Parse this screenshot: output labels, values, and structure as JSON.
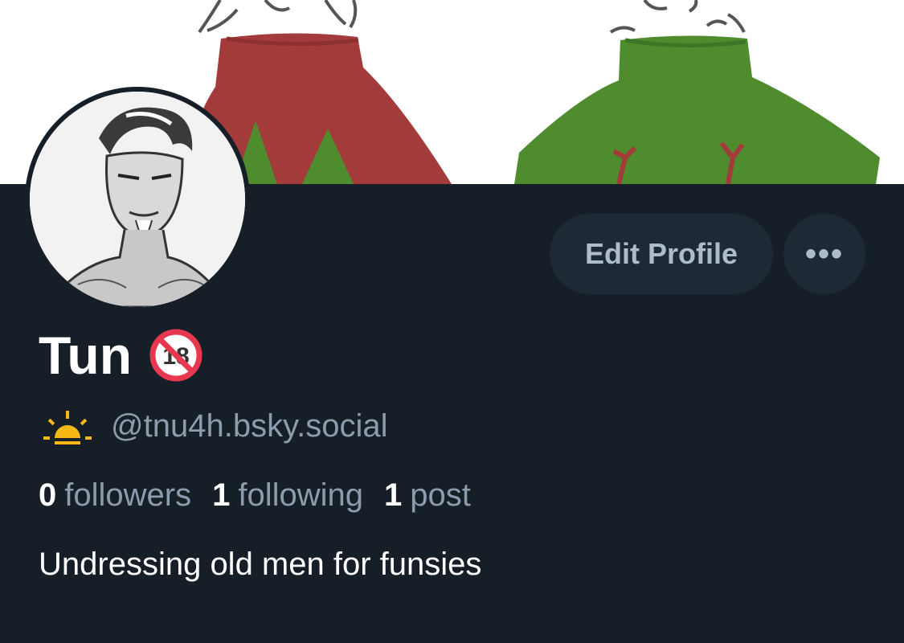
{
  "profile": {
    "display_name": "Tun",
    "name_badge_icon": "no-under-18-icon",
    "status_icon": "sunrise-icon",
    "handle": "@tnu4h.bsky.social",
    "bio": "Undressing old men for funsies",
    "stats": [
      {
        "count": "0",
        "label": "followers"
      },
      {
        "count": "1",
        "label": "following"
      },
      {
        "count": "1",
        "label": "post"
      }
    ]
  },
  "actions": {
    "edit_label": "Edit Profile",
    "more_label": "•••"
  },
  "colors": {
    "background": "#161e27",
    "button_bg": "#1e2936",
    "button_text": "#aebbc9",
    "secondary_text": "#8c9cad",
    "sweater_red": "#a33b3b",
    "sweater_green": "#4e8c2e",
    "sun_yellow": "#f5b817",
    "badge_red": "#e8384f"
  }
}
